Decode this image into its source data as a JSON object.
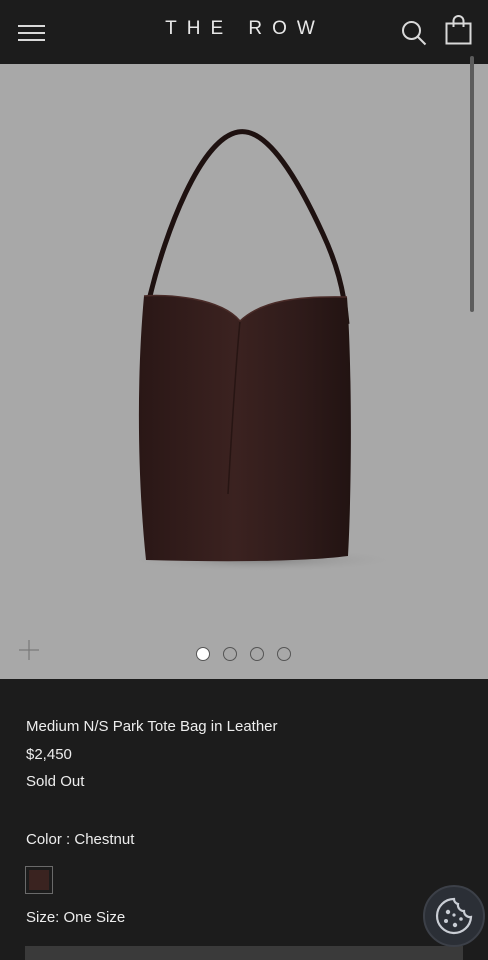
{
  "header": {
    "logo": "THE ROW",
    "menu_icon": "hamburger-menu-icon",
    "search_icon": "search-icon",
    "cart_icon": "shopping-bag-icon"
  },
  "gallery": {
    "image": "medium-ns-park-tote-bag-photo",
    "slide_count": 4,
    "active_slide": 1,
    "zoom_icon": "plus-zoom-icon"
  },
  "product": {
    "title": "Medium N/S Park Tote Bag in Leather",
    "price": "$2,450",
    "availability": "Sold Out",
    "color_label": "Color : ",
    "color_value": "Chestnut",
    "swatch_color": "#3a2320",
    "size_label": "Size: ",
    "size_value": "One Size"
  },
  "cookie": {
    "icon": "cookie-icon"
  },
  "colors": {
    "background": "#1c1c1c",
    "gallery_bg": "#a8a8a8",
    "text": "#ededed"
  }
}
